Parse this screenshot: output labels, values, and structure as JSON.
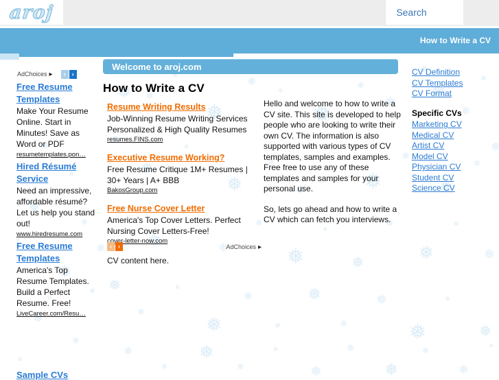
{
  "site": {
    "logo": "aroj",
    "search_label": "Search",
    "breadcrumb": "How to Write a CV"
  },
  "welcome_bar": "Welcome to aroj.com",
  "page_heading": "How to Write a CV",
  "body_paragraphs": [
    "Hello and welcome to how to write a CV site. This site is developed to help people who are looking to write their own CV. The information is also supported with various types of CV templates, samples and examples. Free free to use any of these templates and samples for your personal use.",
    "So, lets go ahead and how to write a CV which can fetch you interviews."
  ],
  "cv_content_note": "CV content here.",
  "left_ads": {
    "adchoices_label": "AdChoices",
    "prev_label": "‹",
    "next_label": "›",
    "items": [
      {
        "title": "Free Resume Templates",
        "body": "Make Your Resume Online. Start in Minutes! Save as Word or PDF",
        "url": "resumetemplates.pon…"
      },
      {
        "title": "Hired Résumé Service",
        "body": "Need an impressive, affordable résumé? Let us help you stand out!",
        "url": "www.hiredresume.com"
      },
      {
        "title": "Free Resume Templates",
        "body": "America's Top Resume Templates. Build a Perfect Resume. Free!",
        "url": "LiveCareer.com/Resu…"
      }
    ],
    "cutoff_heading": "Sample CVs"
  },
  "mid_ads": {
    "adchoices_label": "AdChoices",
    "prev_label": "‹",
    "next_label": "›",
    "items": [
      {
        "title": "Resume Writing Results",
        "body": "Job-Winning Resume Writing Services Personalized & High Quality Resumes",
        "url": "resumes.FINS.com"
      },
      {
        "title": "Executive Resume Working?",
        "body": "Free Resume Critique 1M+ Resumes | 30+ Years | A+ BBB",
        "url": "BakosGroup.com"
      },
      {
        "title": "Free Nurse Cover Letter",
        "body": "America's Top Cover Letters. Perfect Nursing Cover Letters-Free!",
        "url": "cover-letter-now.com"
      }
    ]
  },
  "right_nav": {
    "top_links": [
      "CV Definition",
      "CV Templates",
      "CV Format"
    ],
    "section_heading": "Specific CVs",
    "section_links": [
      "Marketing CV",
      "Medical CV",
      "Artist CV",
      "Model CV",
      "Physician CV",
      "Student CV",
      "Science CV"
    ]
  },
  "colors": {
    "brand_blue": "#5fadd9",
    "link_blue": "#2a7bd4",
    "ad_orange": "#f06c00",
    "snow": "#dfeef8",
    "topbar_grey": "#ededed"
  }
}
